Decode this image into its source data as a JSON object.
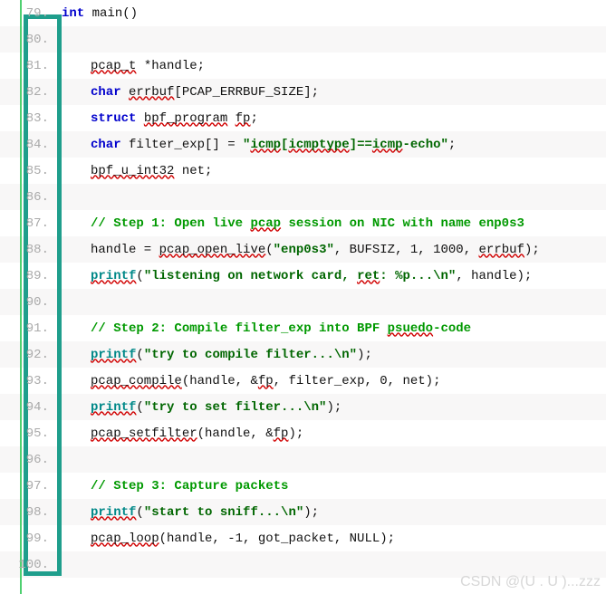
{
  "watermark": "CSDN @(U . U )...zzz",
  "lines": [
    {
      "n": "79.",
      "alt": false,
      "indent": false,
      "tokens": [
        {
          "t": "int",
          "c": "kw"
        },
        {
          "t": " main()",
          "c": "norm"
        }
      ]
    },
    {
      "n": "80.",
      "alt": true,
      "indent": false,
      "tokens": []
    },
    {
      "n": "81.",
      "alt": false,
      "indent": true,
      "tokens": [
        {
          "t": "pcap_t",
          "c": "norm squiggle"
        },
        {
          "t": " *handle;",
          "c": "norm"
        }
      ]
    },
    {
      "n": "82.",
      "alt": true,
      "indent": true,
      "tokens": [
        {
          "t": "char",
          "c": "kw"
        },
        {
          "t": " ",
          "c": "norm"
        },
        {
          "t": "errbuf",
          "c": "norm squiggle"
        },
        {
          "t": "[PCAP_ERRBUF_SIZE];",
          "c": "norm"
        }
      ]
    },
    {
      "n": "83.",
      "alt": false,
      "indent": true,
      "tokens": [
        {
          "t": "struct",
          "c": "kw"
        },
        {
          "t": " ",
          "c": "norm"
        },
        {
          "t": "bpf_program",
          "c": "norm squiggle"
        },
        {
          "t": " ",
          "c": "norm"
        },
        {
          "t": "fp",
          "c": "norm squiggle"
        },
        {
          "t": ";",
          "c": "norm"
        }
      ]
    },
    {
      "n": "84.",
      "alt": true,
      "indent": true,
      "tokens": [
        {
          "t": "char",
          "c": "kw"
        },
        {
          "t": " filter_exp[] = ",
          "c": "norm"
        },
        {
          "t": "\"",
          "c": "str"
        },
        {
          "t": "icmp",
          "c": "str squiggle"
        },
        {
          "t": "[",
          "c": "str"
        },
        {
          "t": "icmptype",
          "c": "str squiggle"
        },
        {
          "t": "]==",
          "c": "str"
        },
        {
          "t": "icmp",
          "c": "str squiggle"
        },
        {
          "t": "-echo\"",
          "c": "str"
        },
        {
          "t": ";",
          "c": "norm"
        }
      ]
    },
    {
      "n": "85.",
      "alt": false,
      "indent": true,
      "tokens": [
        {
          "t": "bpf_u_int32",
          "c": "norm squiggle"
        },
        {
          "t": " net;",
          "c": "norm"
        }
      ]
    },
    {
      "n": "86.",
      "alt": true,
      "indent": false,
      "tokens": []
    },
    {
      "n": "87.",
      "alt": false,
      "indent": true,
      "tokens": [
        {
          "t": "// Step 1: Open live ",
          "c": "cmt"
        },
        {
          "t": "pcap",
          "c": "cmt squiggle"
        },
        {
          "t": " session on NIC with name enp0s3",
          "c": "cmt"
        }
      ]
    },
    {
      "n": "88.",
      "alt": true,
      "indent": true,
      "tokens": [
        {
          "t": "handle = ",
          "c": "norm"
        },
        {
          "t": "pcap_open_live",
          "c": "norm squiggle"
        },
        {
          "t": "(",
          "c": "norm"
        },
        {
          "t": "\"enp0s3\"",
          "c": "str"
        },
        {
          "t": ", BUFSIZ, 1, 1000, ",
          "c": "norm"
        },
        {
          "t": "errbuf",
          "c": "norm squiggle"
        },
        {
          "t": ");",
          "c": "norm"
        }
      ]
    },
    {
      "n": "89.",
      "alt": false,
      "indent": true,
      "tokens": [
        {
          "t": "printf",
          "c": "type squiggle"
        },
        {
          "t": "(",
          "c": "norm"
        },
        {
          "t": "\"listening on network card, ",
          "c": "str"
        },
        {
          "t": "ret",
          "c": "str squiggle"
        },
        {
          "t": ": %p...\\n\"",
          "c": "str"
        },
        {
          "t": ", handle);",
          "c": "norm"
        }
      ]
    },
    {
      "n": "90.",
      "alt": true,
      "indent": false,
      "tokens": []
    },
    {
      "n": "91.",
      "alt": false,
      "indent": true,
      "tokens": [
        {
          "t": "// Step 2: Compile filter_exp into BPF ",
          "c": "cmt"
        },
        {
          "t": "psuedo",
          "c": "cmt squiggle"
        },
        {
          "t": "-code",
          "c": "cmt"
        }
      ]
    },
    {
      "n": "92.",
      "alt": true,
      "indent": true,
      "tokens": [
        {
          "t": "printf",
          "c": "type squiggle"
        },
        {
          "t": "(",
          "c": "norm"
        },
        {
          "t": "\"try to compile filter...\\n\"",
          "c": "str"
        },
        {
          "t": ");",
          "c": "norm"
        }
      ]
    },
    {
      "n": "93.",
      "alt": false,
      "indent": true,
      "tokens": [
        {
          "t": "pcap_compile",
          "c": "norm squiggle"
        },
        {
          "t": "(handle, &",
          "c": "norm"
        },
        {
          "t": "fp",
          "c": "norm squiggle"
        },
        {
          "t": ", filter_exp, 0, net);",
          "c": "norm"
        }
      ]
    },
    {
      "n": "94.",
      "alt": true,
      "indent": true,
      "tokens": [
        {
          "t": "printf",
          "c": "type squiggle"
        },
        {
          "t": "(",
          "c": "norm"
        },
        {
          "t": "\"try to set filter...\\n\"",
          "c": "str"
        },
        {
          "t": ");",
          "c": "norm"
        }
      ]
    },
    {
      "n": "95.",
      "alt": false,
      "indent": true,
      "tokens": [
        {
          "t": "pcap_setfilter",
          "c": "norm squiggle"
        },
        {
          "t": "(handle, &",
          "c": "norm"
        },
        {
          "t": "fp",
          "c": "norm squiggle"
        },
        {
          "t": ");",
          "c": "norm"
        }
      ]
    },
    {
      "n": "96.",
      "alt": true,
      "indent": false,
      "tokens": []
    },
    {
      "n": "97.",
      "alt": false,
      "indent": true,
      "tokens": [
        {
          "t": "// Step 3: Capture packets",
          "c": "cmt"
        }
      ]
    },
    {
      "n": "98.",
      "alt": true,
      "indent": true,
      "tokens": [
        {
          "t": "printf",
          "c": "type squiggle"
        },
        {
          "t": "(",
          "c": "norm"
        },
        {
          "t": "\"start to sniff...\\n\"",
          "c": "str"
        },
        {
          "t": ");",
          "c": "norm"
        }
      ]
    },
    {
      "n": "99.",
      "alt": false,
      "indent": true,
      "tokens": [
        {
          "t": "pcap_loop",
          "c": "norm squiggle"
        },
        {
          "t": "(handle, -1, got_packet, NULL);",
          "c": "norm"
        }
      ]
    },
    {
      "n": "100.",
      "alt": true,
      "indent": false,
      "tokens": []
    }
  ]
}
